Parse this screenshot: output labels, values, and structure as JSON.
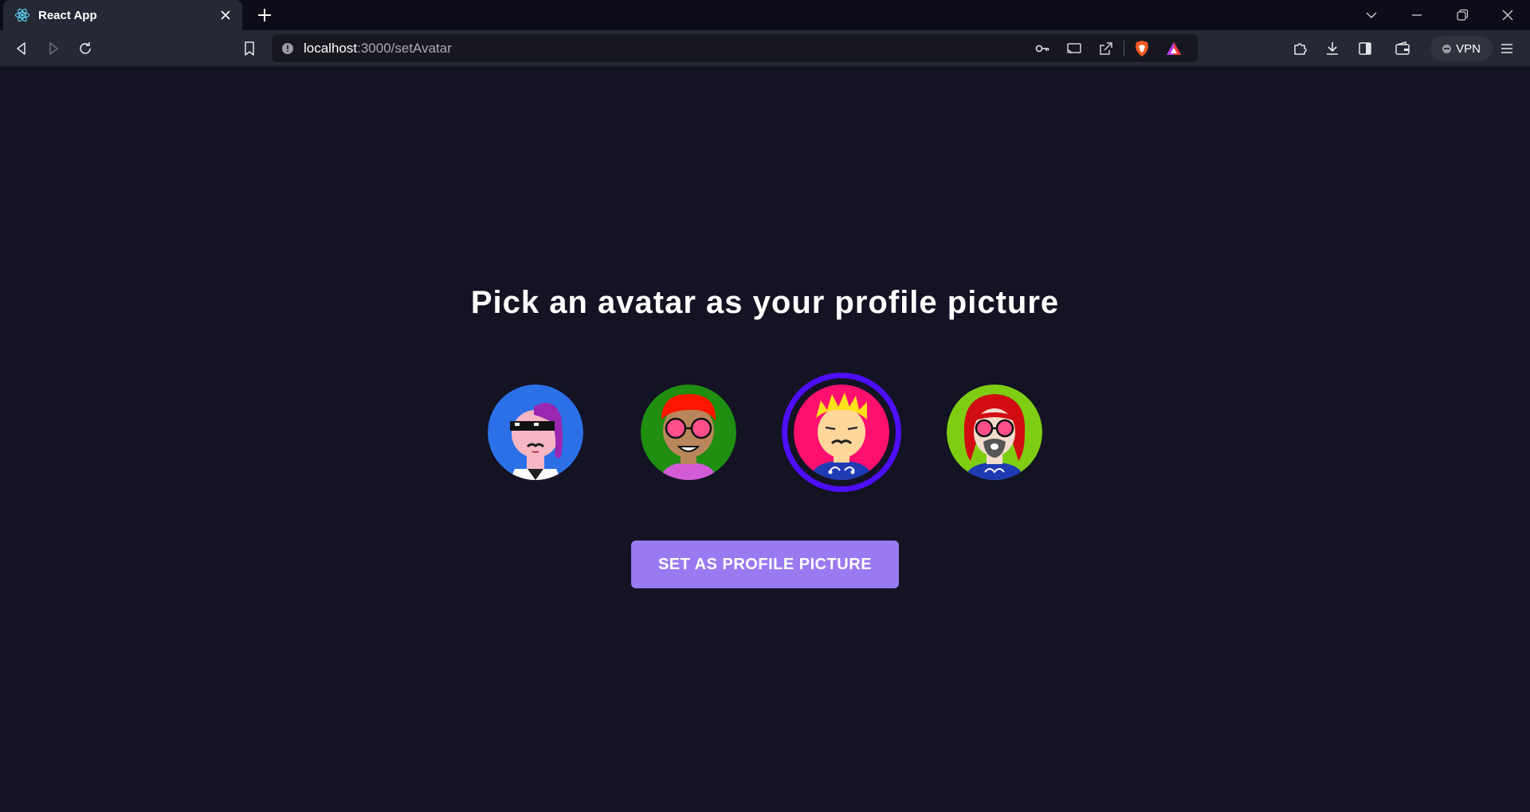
{
  "browser": {
    "tab": {
      "title": "React App"
    },
    "address": {
      "host": "localhost",
      "path": ":3000/setAvatar"
    },
    "vpn_label": "VPN"
  },
  "page": {
    "heading": "Pick an avatar as your profile picture",
    "avatars": [
      {
        "label": "avatar-1",
        "bg": "#2b70e6",
        "selected": false
      },
      {
        "label": "avatar-2",
        "bg": "#1f8e11",
        "selected": false
      },
      {
        "label": "avatar-3",
        "bg": "#ff0f6e",
        "selected": true
      },
      {
        "label": "avatar-4",
        "bg": "#7fcd13",
        "selected": false
      }
    ],
    "button_label": "SET AS PROFILE PICTURE"
  },
  "colors": {
    "background": "#131324",
    "accent": "#997af0",
    "selection_ring": "#4e0eff"
  }
}
